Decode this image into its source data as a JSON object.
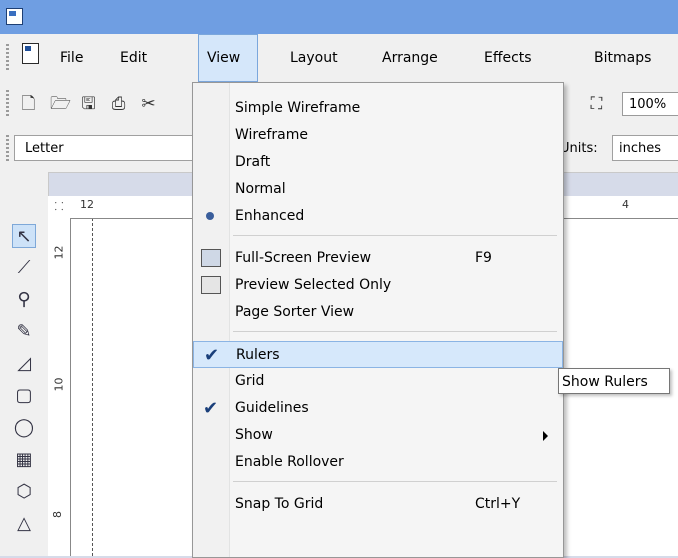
{
  "menubar": {
    "items": [
      "File",
      "Edit",
      "View",
      "Layout",
      "Arrange",
      "Effects",
      "Bitmaps"
    ],
    "active_index": 2
  },
  "toolbar": {
    "zoom_value": "100%"
  },
  "property_bar": {
    "paper_size": "Letter",
    "units_label": "Units:",
    "units_value": "inches"
  },
  "ruler": {
    "corner_label": "⸬",
    "h_labels": [
      "12",
      "4"
    ],
    "v_labels": [
      "12",
      "10",
      "8"
    ]
  },
  "view_menu": {
    "items": [
      {
        "label": "Simple Wireframe",
        "shortcut": "",
        "mark": ""
      },
      {
        "label": "Wireframe",
        "shortcut": "",
        "mark": ""
      },
      {
        "label": "Draft",
        "shortcut": "",
        "mark": ""
      },
      {
        "label": "Normal",
        "shortcut": "",
        "mark": ""
      },
      {
        "label": "Enhanced",
        "shortcut": "",
        "mark": "radio"
      },
      {
        "label": "Full-Screen Preview",
        "shortcut": "F9",
        "mark": "icon"
      },
      {
        "label": "Preview Selected Only",
        "shortcut": "",
        "mark": "icon"
      },
      {
        "label": "Page Sorter View",
        "shortcut": "",
        "mark": ""
      },
      {
        "label": "Rulers",
        "shortcut": "",
        "mark": "check"
      },
      {
        "label": "Grid",
        "shortcut": "",
        "mark": ""
      },
      {
        "label": "Guidelines",
        "shortcut": "",
        "mark": "check"
      },
      {
        "label": "Show",
        "shortcut": "",
        "mark": "submenu"
      },
      {
        "label": "Enable Rollover",
        "shortcut": "",
        "mark": ""
      },
      {
        "label": "Snap To Grid",
        "shortcut": "Ctrl+Y",
        "mark": ""
      }
    ],
    "highlighted": "Rulers"
  },
  "tooltip": {
    "text": "Show Rulers"
  }
}
